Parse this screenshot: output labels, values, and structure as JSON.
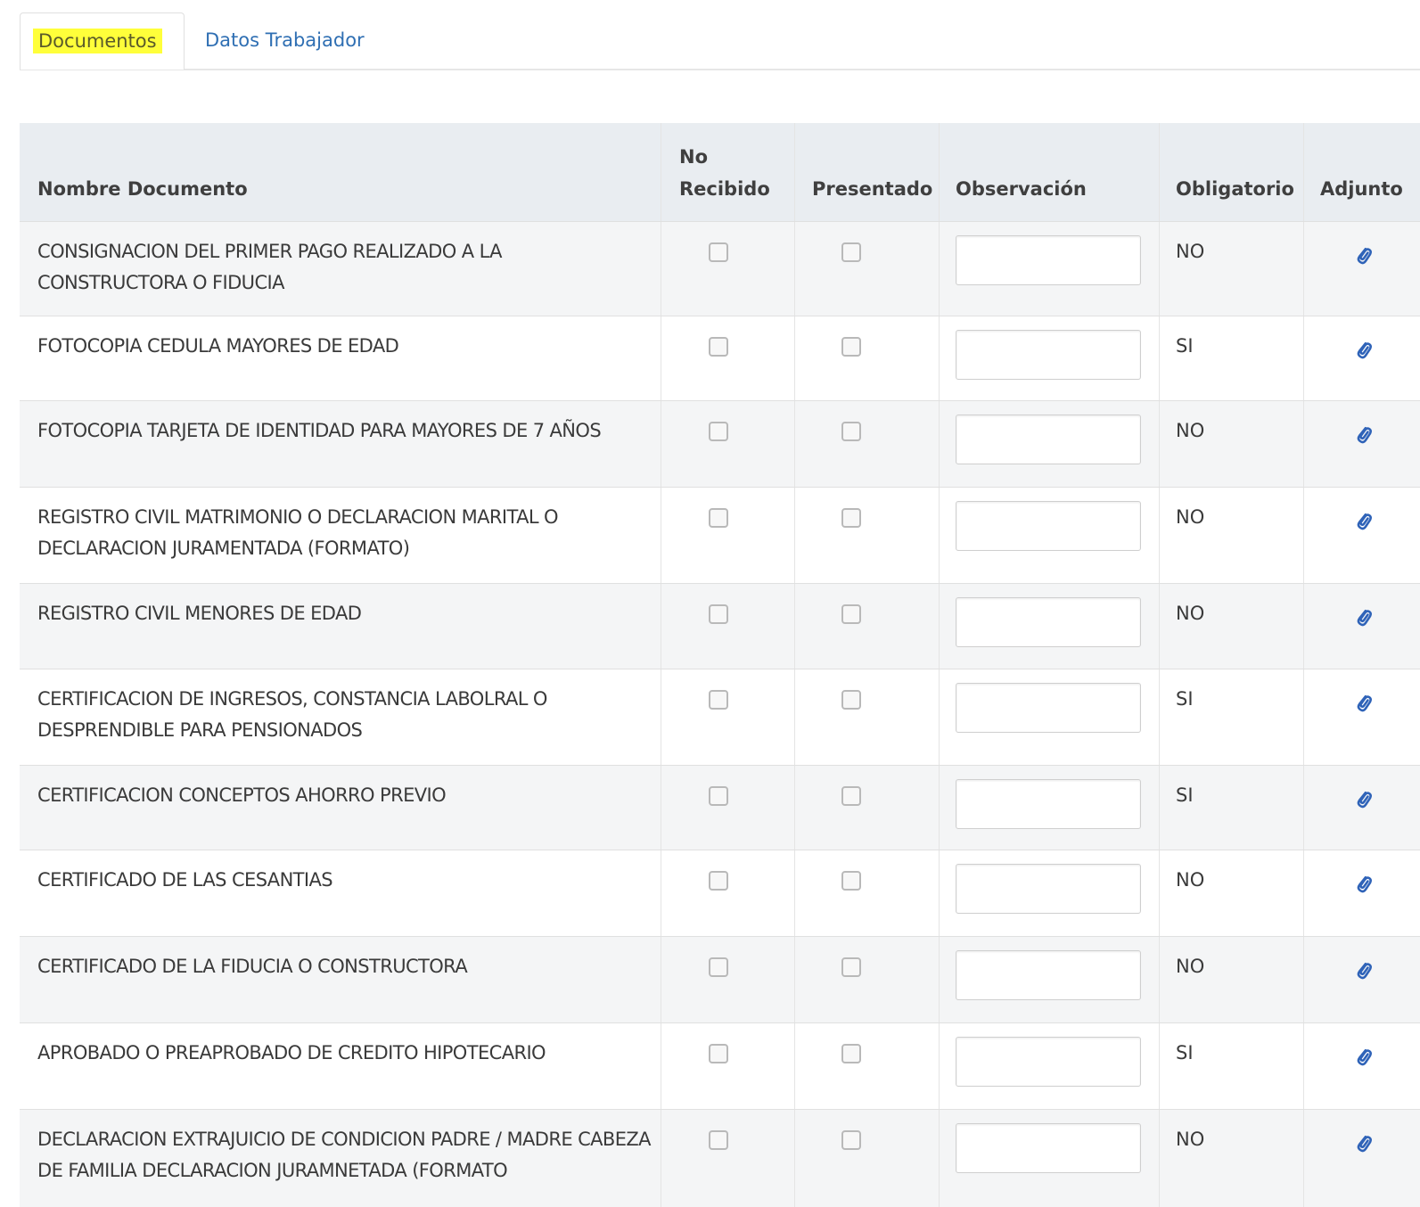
{
  "tabs": [
    {
      "label": "Documentos",
      "active": true
    },
    {
      "label": "Datos Trabajador",
      "active": false
    }
  ],
  "table": {
    "headers": {
      "name": "Nombre Documento",
      "no_recibido_line1": "No",
      "no_recibido_line2": "Recibido",
      "presentado": "Presentado",
      "observacion": "Observación",
      "obligatorio": "Obligatorio",
      "adjunto": "Adjunto"
    },
    "rows": [
      {
        "name": "CONSIGNACION DEL PRIMER PAGO REALIZADO A LA CONSTRUCTORA O FIDUCIA",
        "obligatorio": "NO",
        "observacion": ""
      },
      {
        "name": "FOTOCOPIA CEDULA MAYORES DE EDAD",
        "obligatorio": "SI",
        "observacion": ""
      },
      {
        "name": "FOTOCOPIA TARJETA DE IDENTIDAD PARA MAYORES DE 7 AÑOS",
        "obligatorio": "NO",
        "observacion": ""
      },
      {
        "name": "REGISTRO CIVIL MATRIMONIO O DECLARACION MARITAL O DECLARACION JURAMENTADA (FORMATO)",
        "obligatorio": "NO",
        "observacion": ""
      },
      {
        "name": "REGISTRO CIVIL MENORES DE EDAD",
        "obligatorio": "NO",
        "observacion": ""
      },
      {
        "name": "CERTIFICACION DE INGRESOS, CONSTANCIA LABOLRAL O DESPRENDIBLE PARA PENSIONADOS",
        "obligatorio": "SI",
        "observacion": ""
      },
      {
        "name": "CERTIFICACION CONCEPTOS AHORRO PREVIO",
        "obligatorio": "SI",
        "observacion": ""
      },
      {
        "name": "CERTIFICADO DE LAS CESANTIAS",
        "obligatorio": "NO",
        "observacion": ""
      },
      {
        "name": "CERTIFICADO DE LA FIDUCIA O CONSTRUCTORA",
        "obligatorio": "NO",
        "observacion": ""
      },
      {
        "name": "APROBADO O PREAPROBADO DE CREDITO HIPOTECARIO",
        "obligatorio": "SI",
        "observacion": ""
      },
      {
        "name": "DECLARACION EXTRAJUICIO DE CONDICION PADRE / MADRE CABEZA DE FAMILIA DECLARACION JURAMNETADA (FORMATO",
        "obligatorio": "NO",
        "observacion": ""
      }
    ]
  },
  "icons": {
    "attachment": "paperclip-icon"
  },
  "colors": {
    "tab_highlight": "#ffff3a",
    "link": "#2f6fb3",
    "header_bg": "#e9edf1",
    "row_alt_bg": "#f4f5f6",
    "attachment_icon": "#2f63b8"
  }
}
